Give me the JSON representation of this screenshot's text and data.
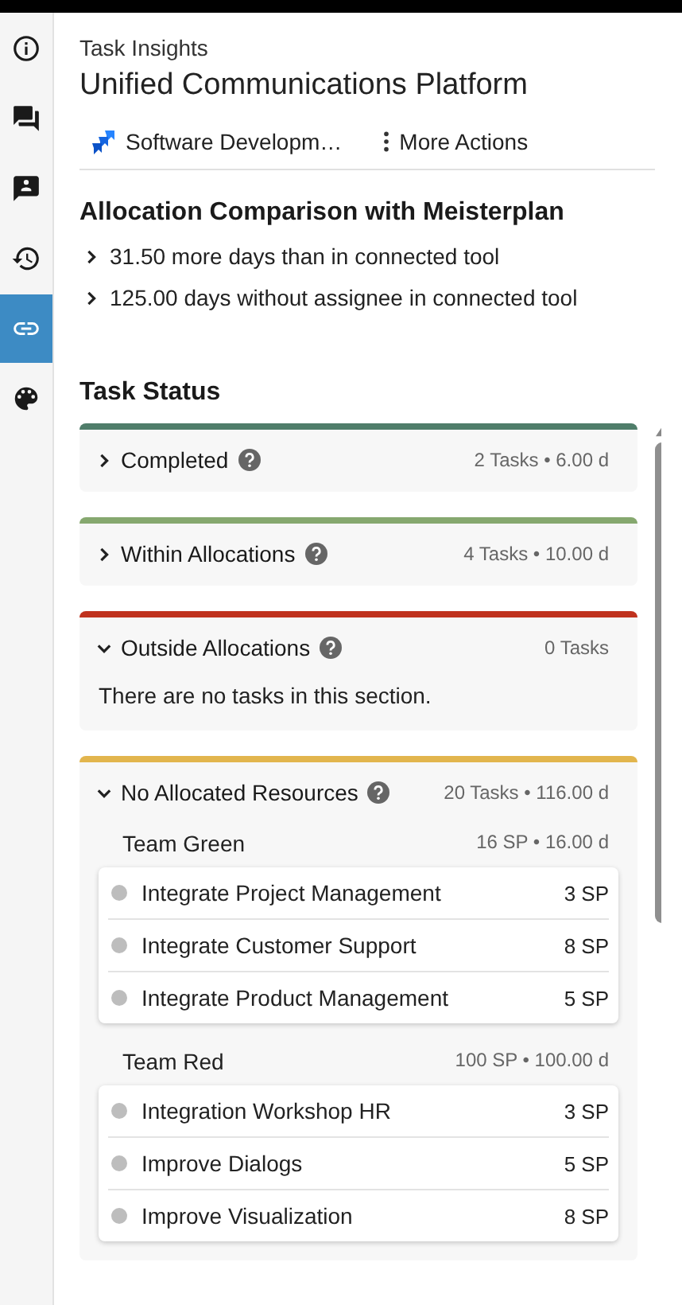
{
  "sidebar": {
    "items": [
      {
        "selected": false
      },
      {
        "selected": false
      },
      {
        "selected": false
      },
      {
        "selected": false
      },
      {
        "selected": true
      },
      {
        "selected": false
      }
    ]
  },
  "header": {
    "subtitle": "Task Insights",
    "title": "Unified Communications Platform"
  },
  "toolbar": {
    "source": "Software Developm…",
    "more_actions": "More Actions"
  },
  "allocation_comparison": {
    "title": "Allocation Comparison with Meisterplan",
    "items": [
      {
        "text": "31.50 more days than in connected tool",
        "expanded": false
      },
      {
        "text": "125.00 days without assignee in connected tool",
        "expanded": false
      }
    ]
  },
  "task_status": {
    "title": "Task Status",
    "sections": [
      {
        "name": "Completed",
        "color": "#4f7d6a",
        "expanded": false,
        "summary": "2 Tasks • 6.00 d"
      },
      {
        "name": "Within Allocations",
        "color": "#86a86f",
        "expanded": false,
        "summary": "4 Tasks • 10.00 d"
      },
      {
        "name": "Outside Allocations",
        "color": "#c0321e",
        "expanded": true,
        "summary": "0 Tasks",
        "empty_text": "There are no tasks in this section."
      },
      {
        "name": "No Allocated Resources",
        "color": "#e2b54d",
        "expanded": true,
        "summary": "20 Tasks • 116.00 d",
        "teams": [
          {
            "name": "Team Green",
            "summary": "16 SP • 16.00 d",
            "tasks": [
              {
                "name": "Integrate Project Management",
                "points": "3 SP"
              },
              {
                "name": "Integrate Customer Support",
                "points": "8 SP"
              },
              {
                "name": "Integrate Product Management",
                "points": "5 SP"
              }
            ]
          },
          {
            "name": "Team Red",
            "summary": "100 SP • 100.00 d",
            "tasks": [
              {
                "name": "Integration Workshop HR",
                "points": "3 SP"
              },
              {
                "name": "Improve Dialogs",
                "points": "5 SP"
              },
              {
                "name": "Improve Visualization",
                "points": "8 SP"
              }
            ]
          }
        ]
      }
    ]
  }
}
